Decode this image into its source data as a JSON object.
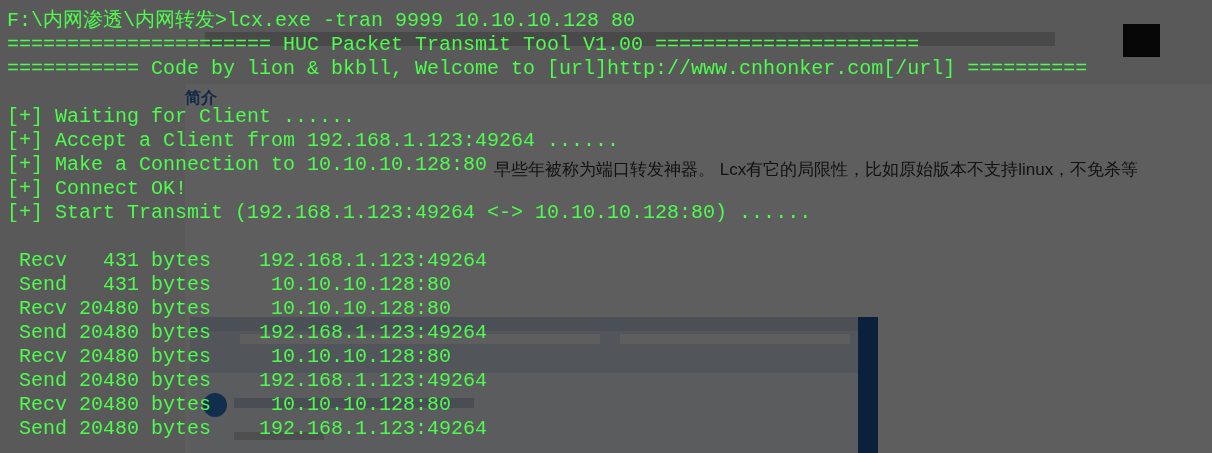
{
  "editor": {
    "heading": "简介",
    "paragraph_fragment": "早些年被称为端口转发神器。 Lcx有它的局限性，比如原始版本不支持linux，不免杀等"
  },
  "terminal": {
    "header_lines": [
      "F:\\内网渗透\\内网转发>lcx.exe -tran 9999 10.10.10.128 80",
      "====================== HUC Packet Transmit Tool V1.00 ======================",
      "=========== Code by lion & bkbll, Welcome to [url]http://www.cnhonker.com[/url] =========="
    ],
    "status_lines": [
      "[+] Waiting for Client ......",
      "[+] Accept a Client from 192.168.1.123:49264 ......",
      "[+] Make a Connection to 10.10.10.128:80",
      "[+] Connect OK!",
      "[+] Start Transmit (192.168.1.123:49264 <-> 10.10.10.128:80) ......"
    ],
    "traffic_lines": [
      " Recv   431 bytes    192.168.1.123:49264",
      " Send   431 bytes     10.10.10.128:80",
      " Recv 20480 bytes     10.10.10.128:80",
      " Send 20480 bytes    192.168.1.123:49264",
      " Recv 20480 bytes     10.10.10.128:80",
      " Send 20480 bytes    192.168.1.123:49264",
      " Recv 20480 bytes     10.10.10.128:80",
      " Send 20480 bytes    192.168.1.123:49264"
    ]
  }
}
